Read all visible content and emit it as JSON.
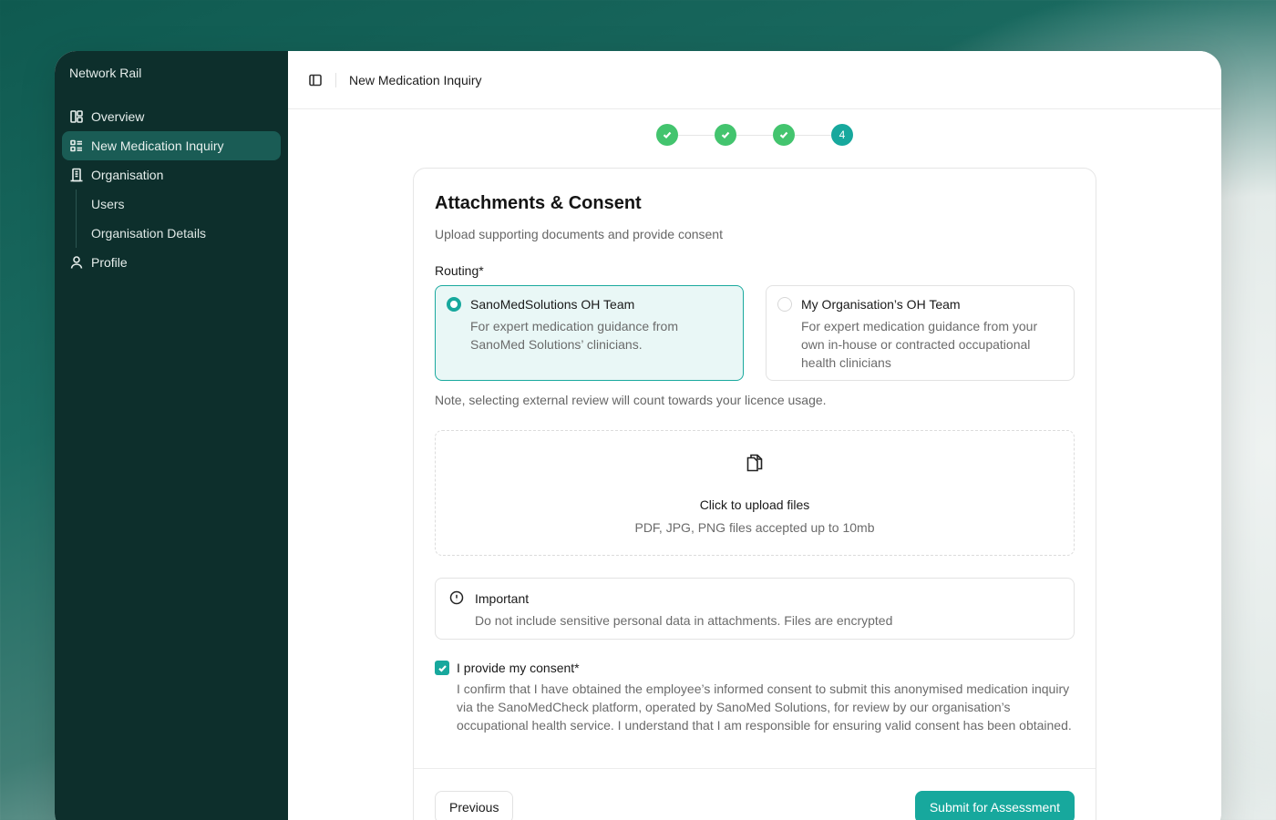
{
  "sidebar": {
    "org_name": "Network Rail",
    "items": [
      {
        "label": "Overview",
        "icon": "dashboard-icon"
      },
      {
        "label": "New Medication Inquiry",
        "icon": "list-icon",
        "active": true
      },
      {
        "label": "Organisation",
        "icon": "building-icon"
      },
      {
        "label": "Profile",
        "icon": "user-icon"
      }
    ],
    "sub_items": [
      "Users",
      "Organisation Details"
    ]
  },
  "header": {
    "title": "New Medication Inquiry"
  },
  "stepper": {
    "current_step": "4",
    "total_steps": 4,
    "completed_steps": 3
  },
  "form": {
    "title": "Attachments & Consent",
    "subtitle": "Upload supporting documents and provide consent",
    "routing_label": "Routing*",
    "routing_options": [
      {
        "title": "SanoMedSolutions OH Team",
        "description": "For expert medication guidance from SanoMed Solutions’ clinicians.",
        "selected": true
      },
      {
        "title": "My Organisation’s OH Team",
        "description": "For expert medication guidance from your own in-house or contracted occupational health clinicians",
        "selected": false
      }
    ],
    "routing_note": "Note, selecting external review will count towards your licence usage.",
    "upload": {
      "title": "Click to upload files",
      "hint": "PDF, JPG, PNG files accepted up to 10mb"
    },
    "important": {
      "title": "Important",
      "text": "Do not include sensitive personal data in attachments. Files are encrypted"
    },
    "consent": {
      "checked": true,
      "label": "I provide my consent*",
      "text": "I confirm that I have obtained the employee’s informed consent to submit this anonymised medication inquiry via the SanoMedCheck platform, operated by SanoMed Solutions, for review by our organisation’s occupational health service. I understand that I am responsible for ensuring valid consent has been obtained."
    },
    "buttons": {
      "previous": "Previous",
      "submit": "Submit for Assessment"
    }
  },
  "colors": {
    "sidebar_bg": "#0d2f2c",
    "sidebar_active": "#1a5c55",
    "accent": "#17a89d",
    "step_done": "#43c46e"
  }
}
